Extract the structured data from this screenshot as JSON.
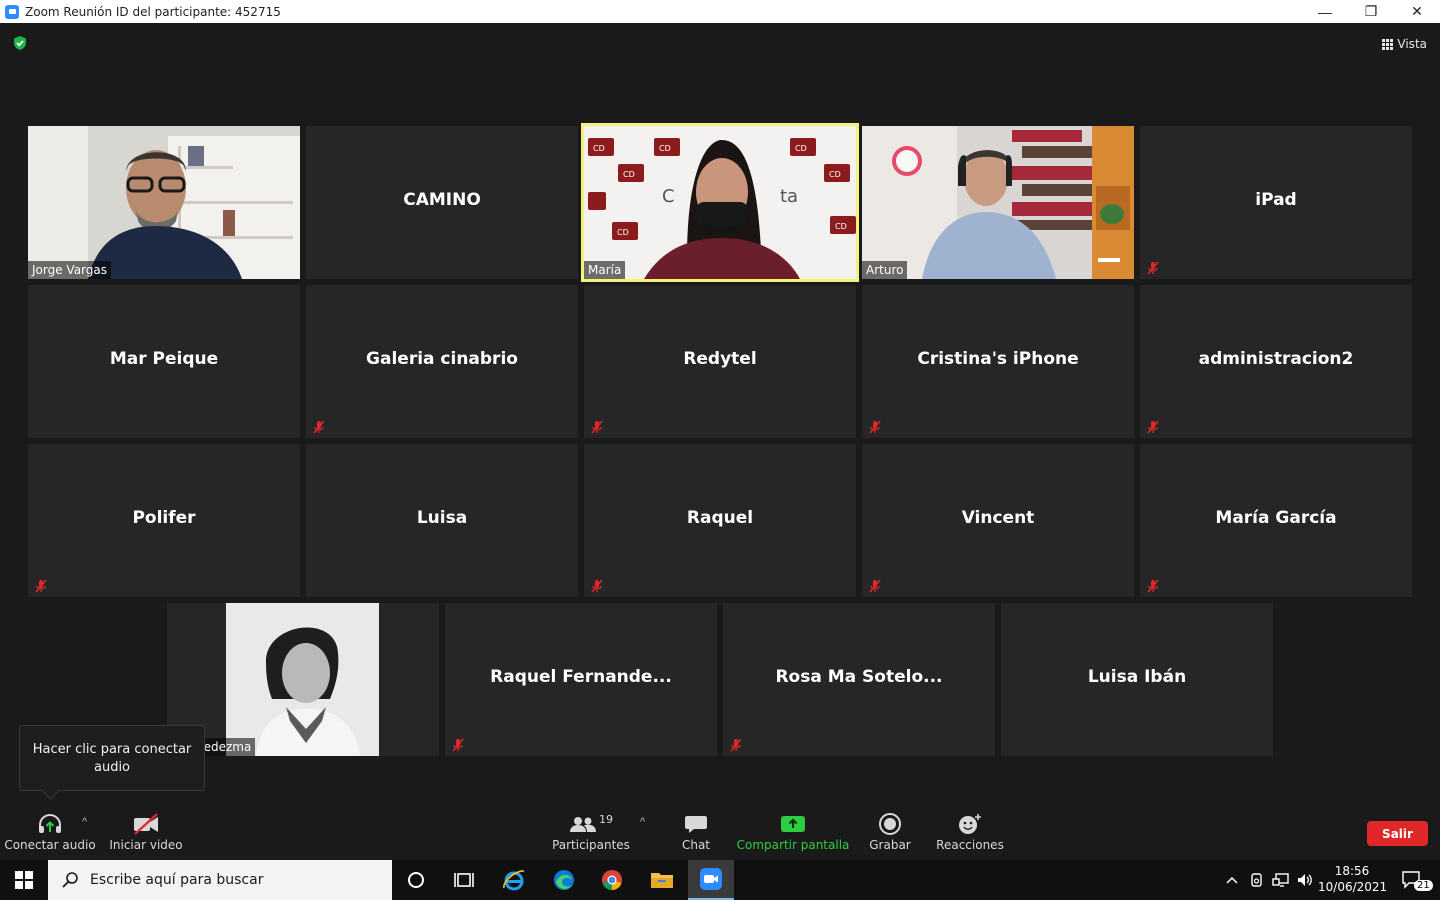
{
  "window": {
    "title": "Zoom Reunión ID del participante: 452715",
    "minimize": "—",
    "restore": "❐",
    "close": "✕"
  },
  "view": {
    "label": "Vista"
  },
  "tiles": [
    {
      "name": "Jorge Vargas",
      "video": true,
      "muted": false
    },
    {
      "name": "CAMINO",
      "video": false,
      "muted": false
    },
    {
      "name": "María",
      "video": true,
      "muted": false,
      "active": true
    },
    {
      "name": "Arturo",
      "video": true,
      "muted": false
    },
    {
      "name": "iPad",
      "video": false,
      "muted": true
    },
    {
      "name": "Mar Peique",
      "video": false,
      "muted": false
    },
    {
      "name": "Galeria cinabrio",
      "video": false,
      "muted": true
    },
    {
      "name": "Redytel",
      "video": false,
      "muted": true
    },
    {
      "name": "Cristina's iPhone",
      "video": false,
      "muted": true
    },
    {
      "name": "administracion2",
      "video": false,
      "muted": true
    },
    {
      "name": "Polifer",
      "video": false,
      "muted": true
    },
    {
      "name": "Luisa",
      "video": false,
      "muted": false
    },
    {
      "name": "Raquel",
      "video": false,
      "muted": true
    },
    {
      "name": "Vincent",
      "video": false,
      "muted": true
    },
    {
      "name": "María García",
      "video": false,
      "muted": true
    },
    {
      "name": "ana Ledezma",
      "video": false,
      "photo": true,
      "muted": false
    },
    {
      "name": "Raquel  Fernande...",
      "video": false,
      "muted": true
    },
    {
      "name": "Rosa  Ma  Sotelo...",
      "video": false,
      "muted": true
    },
    {
      "name": "Luisa Ibán",
      "video": false,
      "muted": false
    }
  ],
  "tooltip": {
    "text": "Hacer clic para conectar audio"
  },
  "toolbar": {
    "audio": "Conectar audio",
    "video": "Iniciar video",
    "participants": "Participantes",
    "participants_count": "19",
    "chat": "Chat",
    "share": "Compartir pantalla",
    "record": "Grabar",
    "reactions": "Reacciones",
    "leave": "Salir"
  },
  "taskbar": {
    "search_placeholder": "Escribe aquí para buscar",
    "time": "18:56",
    "date": "10/06/2021",
    "notifications": "21"
  },
  "colors": {
    "active_speaker": "#f3f37a",
    "share_green": "#2ecc40",
    "leave_red": "#e02828",
    "zoom_blue": "#2d8cff"
  }
}
